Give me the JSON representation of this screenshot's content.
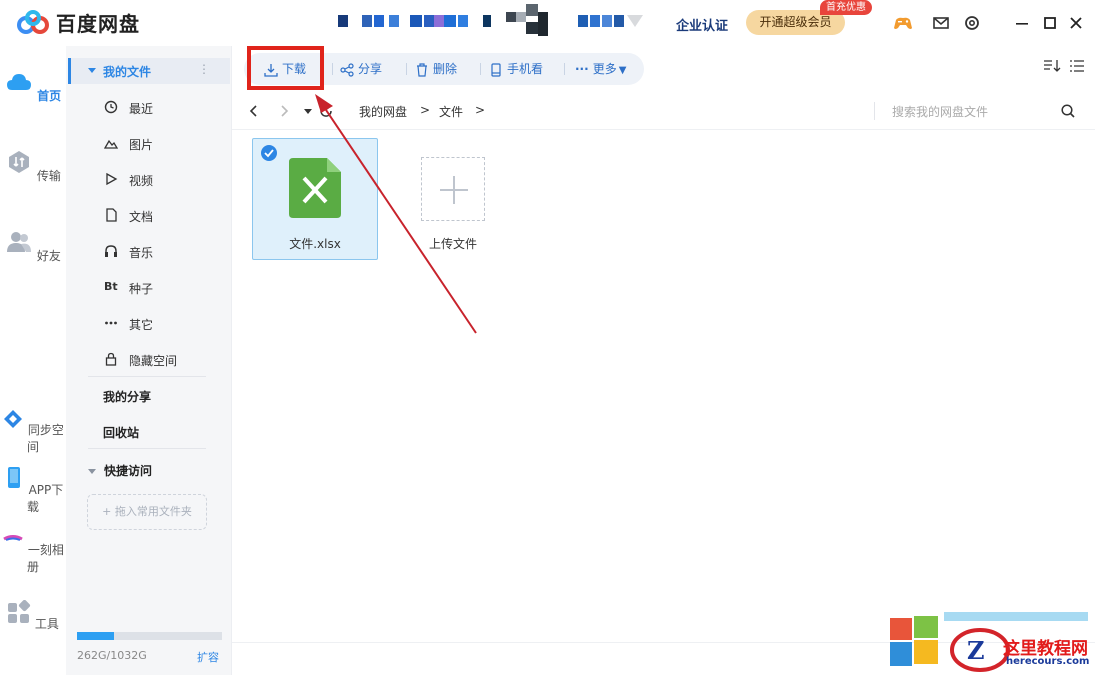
{
  "app": {
    "title": "百度网盘"
  },
  "header": {
    "enterprise_label": "企业认证",
    "vip_label": "开通超级会员",
    "vip_badge": "首充优惠",
    "icons": [
      "gamepad-icon",
      "mail-icon",
      "settings-icon",
      "minimize-icon",
      "maximize-icon",
      "close-icon"
    ]
  },
  "rail": {
    "items": [
      {
        "label": "首页",
        "icon": "cloud-icon",
        "active": true
      },
      {
        "label": "传输",
        "icon": "transfer-icon"
      },
      {
        "label": "好友",
        "icon": "friends-icon"
      },
      {
        "label": "同步空间",
        "icon": "sync-icon"
      },
      {
        "label": "APP下载",
        "icon": "phone-icon"
      },
      {
        "label": "一刻相册",
        "icon": "album-icon"
      },
      {
        "label": "工具",
        "icon": "tools-icon"
      }
    ]
  },
  "sidebar": {
    "section_title": "我的文件",
    "items": [
      {
        "label": "最近",
        "icon": "clock-icon"
      },
      {
        "label": "图片",
        "icon": "image-icon"
      },
      {
        "label": "视频",
        "icon": "play-icon"
      },
      {
        "label": "文档",
        "icon": "document-icon"
      },
      {
        "label": "音乐",
        "icon": "headphones-icon"
      },
      {
        "label": "种子",
        "icon_text": "Bt"
      },
      {
        "label": "其它",
        "icon": "more-icon"
      },
      {
        "label": "隐藏空间",
        "icon": "lock-icon"
      }
    ],
    "my_share": "我的分享",
    "recycle_bin": "回收站",
    "quick_access": "快捷访问",
    "drop_folder": "+ 拖入常用文件夹",
    "quota_text": "262G/1032G",
    "quota_fraction": 0.254,
    "expand_label": "扩容"
  },
  "toolbar": {
    "download": "下载",
    "share": "分享",
    "delete": "删除",
    "phone_view": "手机看",
    "more": "更多"
  },
  "breadcrumb": {
    "root": "我的网盘",
    "folder": "文件",
    "separator": ">"
  },
  "search": {
    "placeholder": "搜索我的网盘文件"
  },
  "files": [
    {
      "name": "文件.xlsx",
      "type": "xlsx",
      "selected": true
    }
  ],
  "upload_label": "上传文件",
  "watermark": {
    "title": "这里教程网",
    "url": "herecours.com"
  },
  "colors": {
    "accent": "#2d86e4",
    "highlight_box": "#e0241b",
    "arrow": "#c8232c",
    "excel_green": "#5aac44"
  }
}
